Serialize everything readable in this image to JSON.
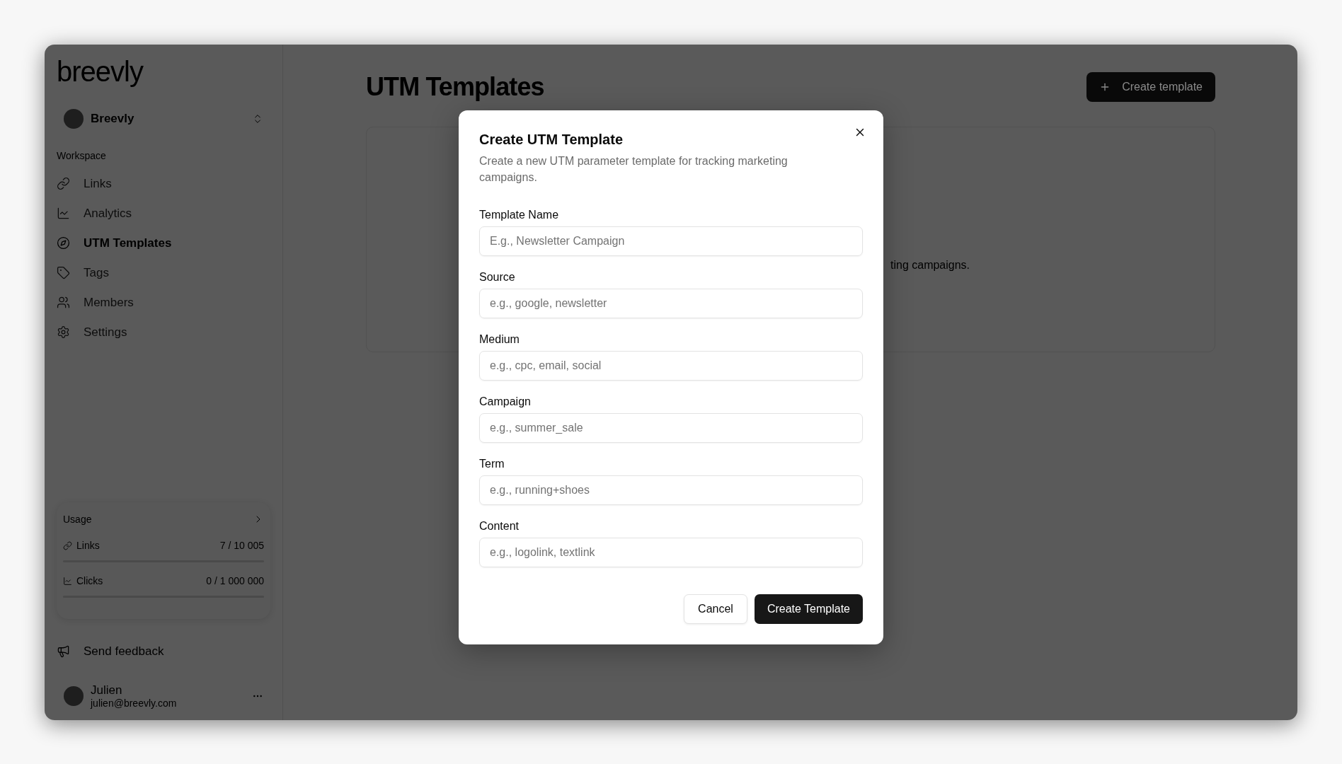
{
  "sidebar": {
    "logo": "breevly",
    "workspace": {
      "name": "Breevly"
    },
    "section": "Workspace",
    "items": [
      {
        "label": "Links",
        "selected": false
      },
      {
        "label": "Analytics",
        "selected": false
      },
      {
        "label": "UTM Templates",
        "selected": true
      },
      {
        "label": "Tags",
        "selected": false
      },
      {
        "label": "Members",
        "selected": false
      },
      {
        "label": "Settings",
        "selected": false
      }
    ],
    "usage": {
      "title": "Usage",
      "items": [
        {
          "label": "Links",
          "reading": "7 / 10 005"
        },
        {
          "label": "Clicks",
          "reading": "0 / 1 000 000"
        }
      ]
    },
    "feedback": "Send feedback",
    "user": {
      "name": "Julien",
      "email": "julien@breevly.com"
    }
  },
  "main": {
    "title": "UTM Templates",
    "create_button": "Create template",
    "card_text": "ting campaigns."
  },
  "dialog": {
    "title": "Create UTM Template",
    "description": "Create a new UTM parameter template for tracking marketing campaigns.",
    "fields": [
      {
        "label": "Template Name",
        "placeholder": "E.g., Newsletter Campaign"
      },
      {
        "label": "Source",
        "placeholder": "e.g., google, newsletter"
      },
      {
        "label": "Medium",
        "placeholder": "e.g., cpc, email, social"
      },
      {
        "label": "Campaign",
        "placeholder": "e.g., summer_sale"
      },
      {
        "label": "Term",
        "placeholder": "e.g., running+shoes"
      },
      {
        "label": "Content",
        "placeholder": "e.g., logolink, textlink"
      }
    ],
    "cancel": "Cancel",
    "submit": "Create Template"
  }
}
